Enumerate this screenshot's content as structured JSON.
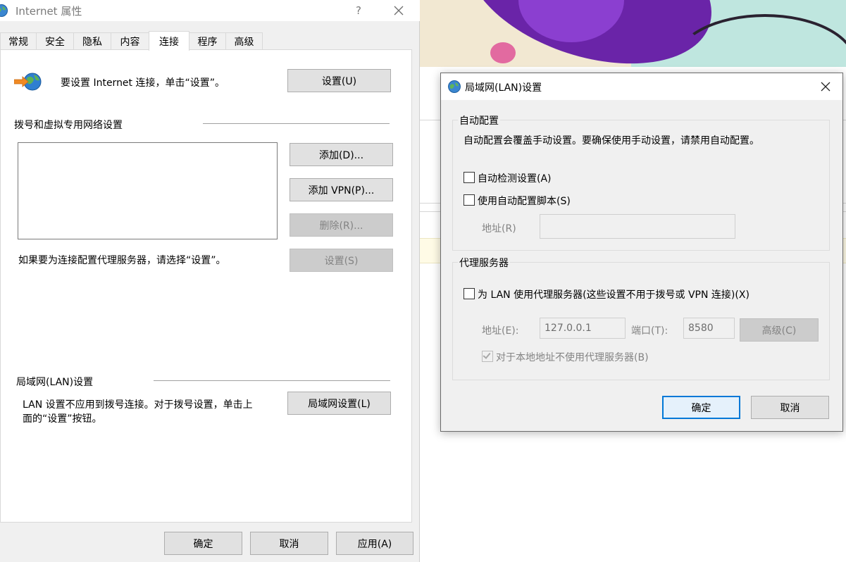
{
  "internet_props": {
    "title": "Internet 属性",
    "help": "?",
    "tabs": [
      {
        "label": "常规"
      },
      {
        "label": "安全"
      },
      {
        "label": "隐私"
      },
      {
        "label": "内容"
      },
      {
        "label": "连接",
        "active": true
      },
      {
        "label": "程序"
      },
      {
        "label": "高级"
      }
    ],
    "setup_text": "要设置 Internet 连接，单击“设置”。",
    "setup_button": "设置(U)",
    "dialup_section": "拨号和虚拟专用网络设置",
    "add_button": "添加(D)...",
    "add_vpn_button": "添加 VPN(P)...",
    "remove_button": "删除(R)...",
    "proxy_hint": "如果要为连接配置代理服务器，请选择“设置”。",
    "settings_button": "设置(S)",
    "lan_section": "局域网(LAN)设置",
    "lan_text_line1": "LAN 设置不应用到拨号连接。对于拨号设置，单击上",
    "lan_text_line2": "面的“设置”按钮。",
    "lan_settings_button": "局域网设置(L)",
    "ok_button": "确定",
    "cancel_button": "取消",
    "apply_button": "应用(A)"
  },
  "lan_dialog": {
    "title": "局域网(LAN)设置",
    "auto_group": "自动配置",
    "auto_desc": "自动配置会覆盖手动设置。要确保使用手动设置，请禁用自动配置。",
    "auto_detect": {
      "label": "自动检测设置(A)",
      "checked": false
    },
    "auto_script": {
      "label": "使用自动配置脚本(S)",
      "checked": false
    },
    "script_address_label": "地址(R)",
    "script_address_value": "",
    "proxy_group": "代理服务器",
    "use_proxy": {
      "label": "为 LAN 使用代理服务器(这些设置不用于拨号或 VPN 连接)(X)",
      "checked": false
    },
    "address_label": "地址(E):",
    "address_value": "127.0.0.1",
    "port_label": "端口(T):",
    "port_value": "8580",
    "advanced_button": "高级(C)",
    "bypass_local": {
      "label": "对于本地地址不使用代理服务器(B)",
      "checked": true
    },
    "ok_button": "确定",
    "cancel_button": "取消"
  }
}
